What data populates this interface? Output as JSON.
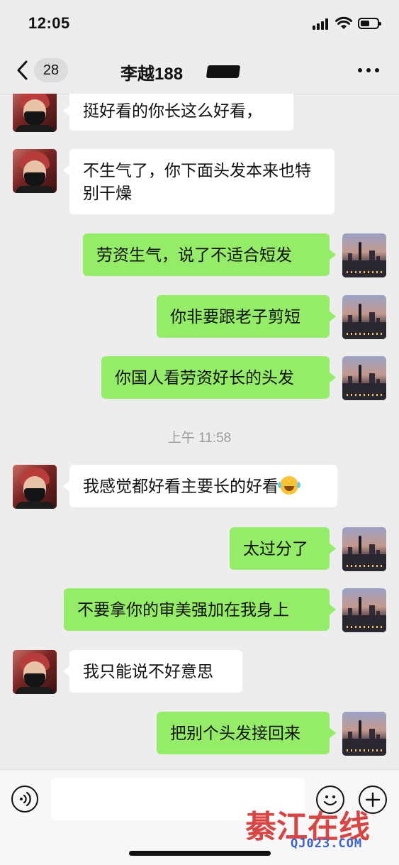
{
  "status_bar": {
    "time": "12:05"
  },
  "nav": {
    "unread_count": "28",
    "contact_name": "李越188"
  },
  "messages": [
    {
      "side": "in",
      "text": "挺好看的你长这么好看，"
    },
    {
      "side": "in",
      "text": "不生气了，你下面头发本来也特别干燥"
    },
    {
      "side": "out",
      "text": "劳资生气，说了不适合短发"
    },
    {
      "side": "out",
      "text": "你非要跟老子剪短"
    },
    {
      "side": "out",
      "text": "你国人看劳资好长的头发"
    },
    {
      "side": "time",
      "text": "上午 11:58"
    },
    {
      "side": "in",
      "text": "我感觉都好看主要长的好看"
    },
    {
      "side": "out",
      "text": "太过分了"
    },
    {
      "side": "out",
      "text": "不要拿你的审美强加在我身上"
    },
    {
      "side": "in",
      "text": "我只能说不好意思"
    },
    {
      "side": "out",
      "text": "把别个头发接回来"
    }
  ],
  "icons": {
    "emoji_in_message": "laughing-tears-emoji"
  },
  "input_bar": {
    "value": ""
  },
  "watermark": {
    "main": "綦江在线",
    "site": "QJ023.COM"
  },
  "colors": {
    "background": "#ededed",
    "incoming_bubble": "#ffffff",
    "outgoing_bubble": "#95ec69",
    "watermark_red": "#d84545",
    "watermark_blue": "#3a63c8"
  }
}
